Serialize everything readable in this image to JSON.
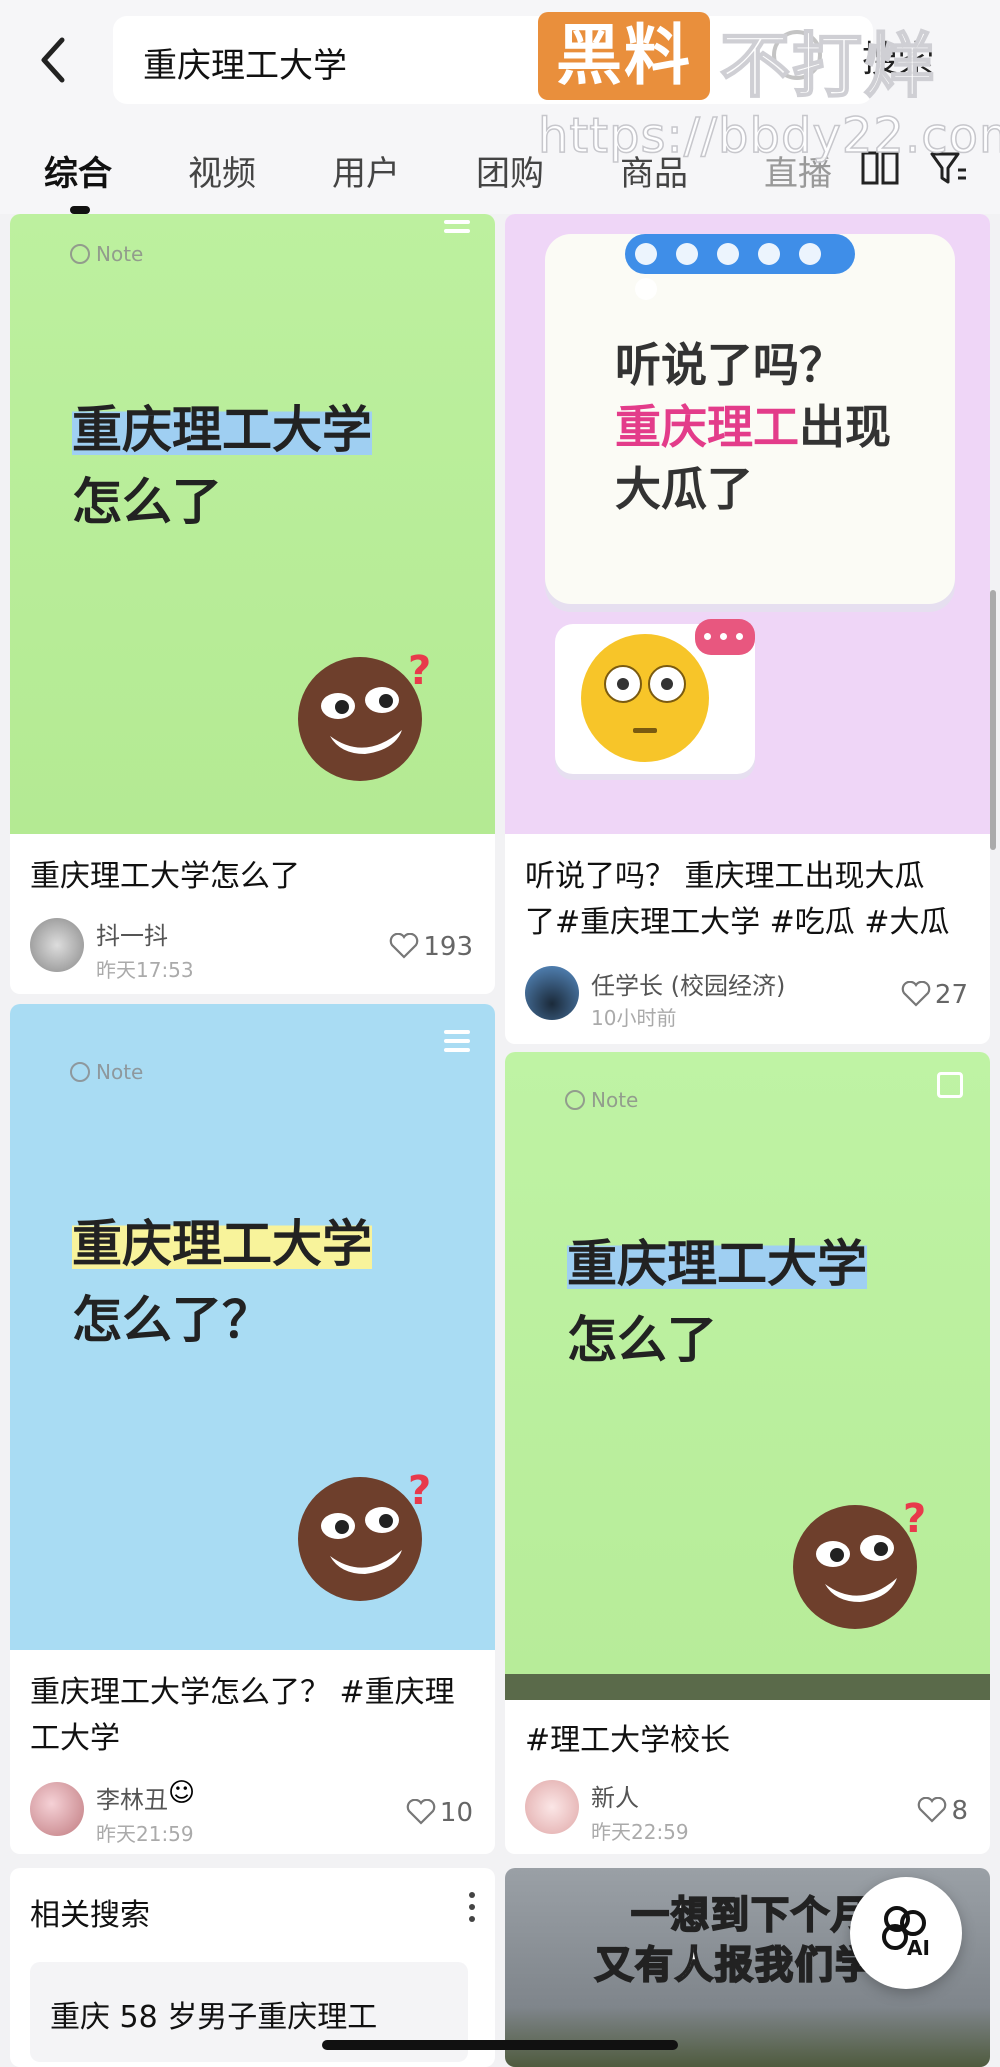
{
  "search": {
    "query": "重庆理工大学",
    "button": "搜索"
  },
  "watermark": {
    "badge": "黑料",
    "text": "不打烊",
    "url": "https://bbdy22.com"
  },
  "tabs": [
    {
      "label": "综合"
    },
    {
      "label": "视频"
    },
    {
      "label": "用户"
    },
    {
      "label": "团购"
    },
    {
      "label": "商品"
    },
    {
      "label": "直播"
    }
  ],
  "cards": [
    {
      "note_label": "Note",
      "cover_line1": "重庆理工大学",
      "cover_line2": "怎么了",
      "title": "重庆理工大学怎么了",
      "author": "抖一抖",
      "time": "昨天17:53",
      "likes": "193"
    },
    {
      "cover_line1": "听说了吗？",
      "cover_line2_pink": "重庆理工",
      "cover_line2_rest": "出现",
      "cover_line3": "大瓜了",
      "title_line1": "听说了吗？ 重庆理工出现大瓜",
      "title_line2": "了#重庆理工大学 #吃瓜 #大瓜",
      "author": "任学长 (校园经济)",
      "time": "10小时前",
      "likes": "27"
    },
    {
      "note_label": "Note",
      "cover_line1": "重庆理工大学",
      "cover_line2": "怎么了？",
      "title_line1": "重庆理工大学怎么了？ #重庆理",
      "title_line2": "工大学",
      "author": "李林丑",
      "time": "昨天21:59",
      "likes": "10"
    },
    {
      "note_label": "Note",
      "cover_line1": "重庆理工大学",
      "cover_line2": "怎么了",
      "title": "#理工大学校长",
      "author": "新人",
      "time": "昨天22:59",
      "likes": "8"
    }
  ],
  "related": {
    "title": "相关搜索",
    "item": "重庆 58 岁男子重庆理工"
  },
  "video": {
    "line1": "一想到下个月",
    "line2": "又有人报我们学"
  },
  "ai_button": "AI",
  "colors": {
    "green": "#b9ef9a",
    "pink_bg": "#eed7f6",
    "blue": "#a8dcf4",
    "accent_pink": "#e33c8a"
  }
}
